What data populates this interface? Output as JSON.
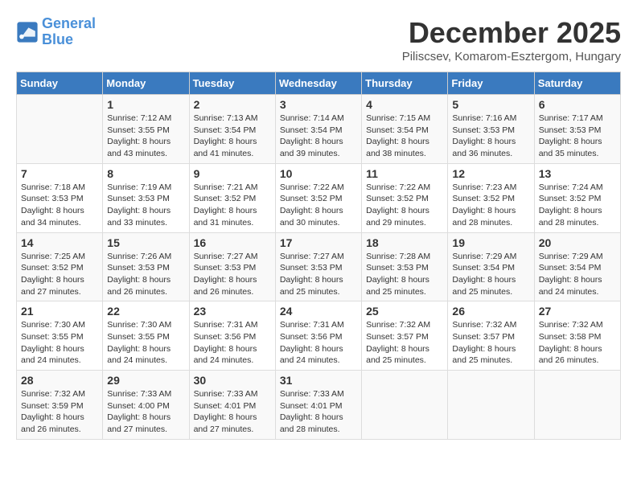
{
  "header": {
    "logo_line1": "General",
    "logo_line2": "Blue",
    "month": "December 2025",
    "location": "Piliscsev, Komarom-Esztergom, Hungary"
  },
  "weekdays": [
    "Sunday",
    "Monday",
    "Tuesday",
    "Wednesday",
    "Thursday",
    "Friday",
    "Saturday"
  ],
  "weeks": [
    [
      {
        "day": "",
        "info": ""
      },
      {
        "day": "1",
        "info": "Sunrise: 7:12 AM\nSunset: 3:55 PM\nDaylight: 8 hours\nand 43 minutes."
      },
      {
        "day": "2",
        "info": "Sunrise: 7:13 AM\nSunset: 3:54 PM\nDaylight: 8 hours\nand 41 minutes."
      },
      {
        "day": "3",
        "info": "Sunrise: 7:14 AM\nSunset: 3:54 PM\nDaylight: 8 hours\nand 39 minutes."
      },
      {
        "day": "4",
        "info": "Sunrise: 7:15 AM\nSunset: 3:54 PM\nDaylight: 8 hours\nand 38 minutes."
      },
      {
        "day": "5",
        "info": "Sunrise: 7:16 AM\nSunset: 3:53 PM\nDaylight: 8 hours\nand 36 minutes."
      },
      {
        "day": "6",
        "info": "Sunrise: 7:17 AM\nSunset: 3:53 PM\nDaylight: 8 hours\nand 35 minutes."
      }
    ],
    [
      {
        "day": "7",
        "info": "Sunrise: 7:18 AM\nSunset: 3:53 PM\nDaylight: 8 hours\nand 34 minutes."
      },
      {
        "day": "8",
        "info": "Sunrise: 7:19 AM\nSunset: 3:53 PM\nDaylight: 8 hours\nand 33 minutes."
      },
      {
        "day": "9",
        "info": "Sunrise: 7:21 AM\nSunset: 3:52 PM\nDaylight: 8 hours\nand 31 minutes."
      },
      {
        "day": "10",
        "info": "Sunrise: 7:22 AM\nSunset: 3:52 PM\nDaylight: 8 hours\nand 30 minutes."
      },
      {
        "day": "11",
        "info": "Sunrise: 7:22 AM\nSunset: 3:52 PM\nDaylight: 8 hours\nand 29 minutes."
      },
      {
        "day": "12",
        "info": "Sunrise: 7:23 AM\nSunset: 3:52 PM\nDaylight: 8 hours\nand 28 minutes."
      },
      {
        "day": "13",
        "info": "Sunrise: 7:24 AM\nSunset: 3:52 PM\nDaylight: 8 hours\nand 28 minutes."
      }
    ],
    [
      {
        "day": "14",
        "info": "Sunrise: 7:25 AM\nSunset: 3:52 PM\nDaylight: 8 hours\nand 27 minutes."
      },
      {
        "day": "15",
        "info": "Sunrise: 7:26 AM\nSunset: 3:53 PM\nDaylight: 8 hours\nand 26 minutes."
      },
      {
        "day": "16",
        "info": "Sunrise: 7:27 AM\nSunset: 3:53 PM\nDaylight: 8 hours\nand 26 minutes."
      },
      {
        "day": "17",
        "info": "Sunrise: 7:27 AM\nSunset: 3:53 PM\nDaylight: 8 hours\nand 25 minutes."
      },
      {
        "day": "18",
        "info": "Sunrise: 7:28 AM\nSunset: 3:53 PM\nDaylight: 8 hours\nand 25 minutes."
      },
      {
        "day": "19",
        "info": "Sunrise: 7:29 AM\nSunset: 3:54 PM\nDaylight: 8 hours\nand 25 minutes."
      },
      {
        "day": "20",
        "info": "Sunrise: 7:29 AM\nSunset: 3:54 PM\nDaylight: 8 hours\nand 24 minutes."
      }
    ],
    [
      {
        "day": "21",
        "info": "Sunrise: 7:30 AM\nSunset: 3:55 PM\nDaylight: 8 hours\nand 24 minutes."
      },
      {
        "day": "22",
        "info": "Sunrise: 7:30 AM\nSunset: 3:55 PM\nDaylight: 8 hours\nand 24 minutes."
      },
      {
        "day": "23",
        "info": "Sunrise: 7:31 AM\nSunset: 3:56 PM\nDaylight: 8 hours\nand 24 minutes."
      },
      {
        "day": "24",
        "info": "Sunrise: 7:31 AM\nSunset: 3:56 PM\nDaylight: 8 hours\nand 24 minutes."
      },
      {
        "day": "25",
        "info": "Sunrise: 7:32 AM\nSunset: 3:57 PM\nDaylight: 8 hours\nand 25 minutes."
      },
      {
        "day": "26",
        "info": "Sunrise: 7:32 AM\nSunset: 3:57 PM\nDaylight: 8 hours\nand 25 minutes."
      },
      {
        "day": "27",
        "info": "Sunrise: 7:32 AM\nSunset: 3:58 PM\nDaylight: 8 hours\nand 26 minutes."
      }
    ],
    [
      {
        "day": "28",
        "info": "Sunrise: 7:32 AM\nSunset: 3:59 PM\nDaylight: 8 hours\nand 26 minutes."
      },
      {
        "day": "29",
        "info": "Sunrise: 7:33 AM\nSunset: 4:00 PM\nDaylight: 8 hours\nand 27 minutes."
      },
      {
        "day": "30",
        "info": "Sunrise: 7:33 AM\nSunset: 4:01 PM\nDaylight: 8 hours\nand 27 minutes."
      },
      {
        "day": "31",
        "info": "Sunrise: 7:33 AM\nSunset: 4:01 PM\nDaylight: 8 hours\nand 28 minutes."
      },
      {
        "day": "",
        "info": ""
      },
      {
        "day": "",
        "info": ""
      },
      {
        "day": "",
        "info": ""
      }
    ]
  ]
}
